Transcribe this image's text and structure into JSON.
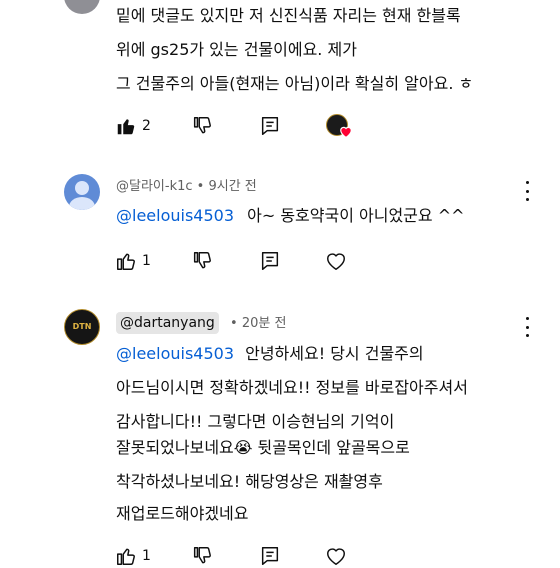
{
  "comment0": {
    "lines": [
      "밑에 댓글도 있지만 저 신진식품 자리는 현재 한블록",
      "위에 gs25가 있는 건물이에요. 제가",
      "그 건물주의 아들(현재는 아님)이라 확실히 알아요. ㅎ"
    ],
    "like_count": "2"
  },
  "comment1": {
    "author": "@달라이-k1c",
    "time": "9시간 전",
    "mention": "@leelouis4503",
    "text": "아~ 동호약국이 아니었군요 ^^",
    "like_count": "1"
  },
  "comment2": {
    "author": "@dartanyang",
    "time": "20분 전",
    "mention": "@leelouis4503",
    "line1_rest": "안녕하세요! 당시 건물주의",
    "lines": [
      "아드님이시면 정확하겠네요!! 정보를 바로잡아주셔서",
      "감사합니다!! 그렇다면 이승현님의 기억이",
      "잘못되었나보네요😭 뒷골목인데 앞골목으로",
      "착각하셨나보네요! 해당영상은 재촬영후",
      "재업로드해야겠네요"
    ],
    "like_count": "1",
    "avatar_text": "DTN"
  },
  "colors": {
    "mention": "#065fd4",
    "meta": "#606060",
    "avatar_blue": "#5f8bd6",
    "heart": "#ff0033"
  },
  "icons": [
    "like-icon",
    "dislike-icon",
    "reply-icon",
    "creator-heart-icon",
    "more-icon"
  ],
  "meta_separator": "•"
}
